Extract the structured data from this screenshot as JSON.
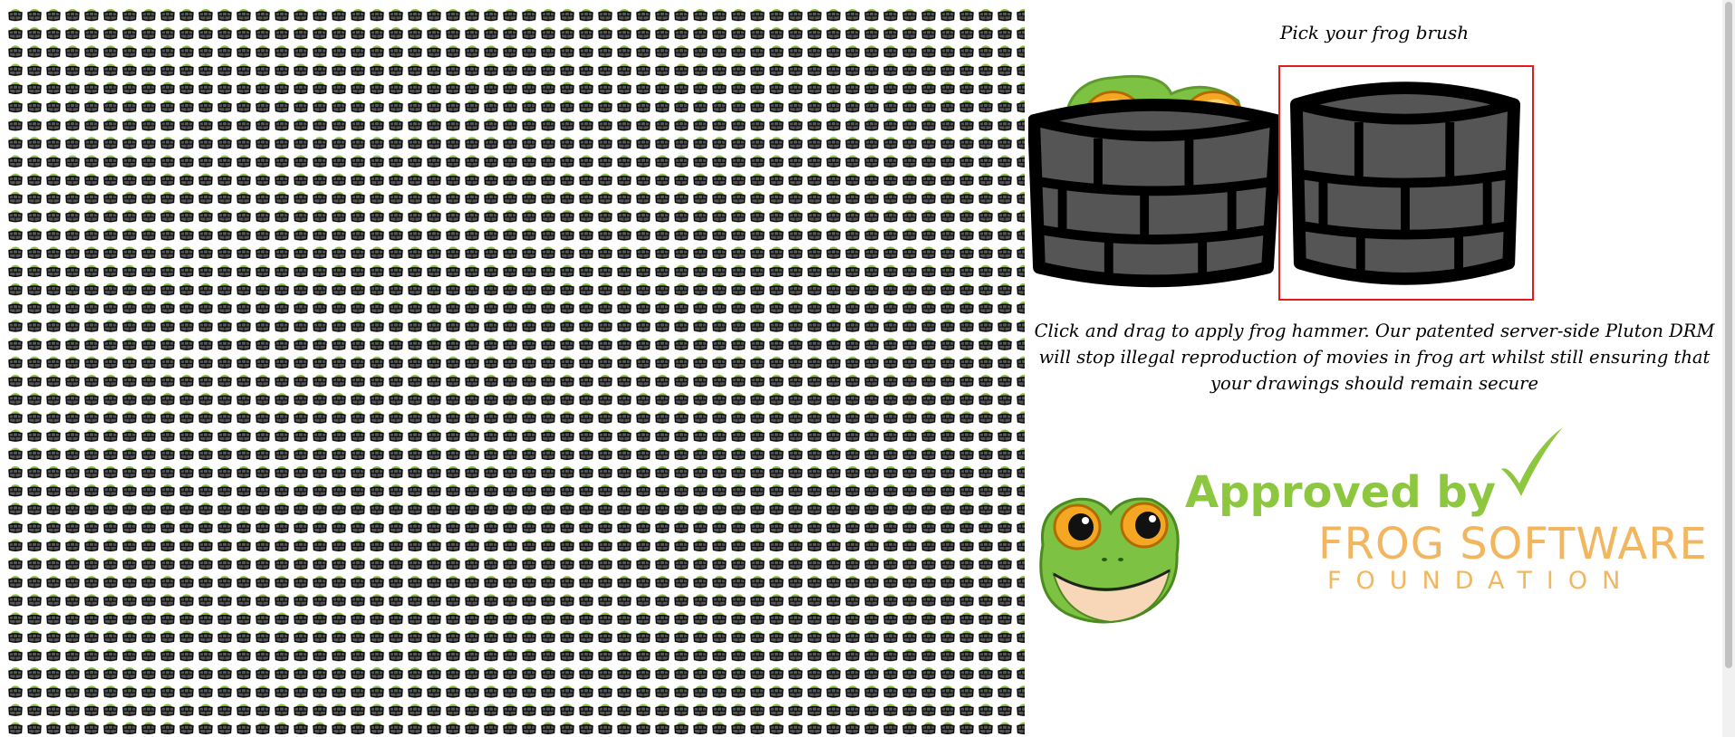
{
  "brush_picker": {
    "title": "Pick your frog brush",
    "brushes": [
      {
        "name": "frog-in-well",
        "selected": false
      },
      {
        "name": "empty-well",
        "selected": true
      }
    ],
    "selected_outline_color": "#e31b1b"
  },
  "instructions": "Click and drag to apply frog hammer. Our patented server-side Pluton DRM will stop illegal reproduction of movies in frog art whilst still ensuring that your drawings should remain secure",
  "badge": {
    "approved_text": "Approved by",
    "org_name": "FROG SOFTWARE",
    "org_sub": "FOUNDATION",
    "icons": [
      "frog-face-icon",
      "checkmark-icon"
    ],
    "colors": {
      "green": "#8dc63f",
      "orange": "#f2b661"
    }
  },
  "canvas": {
    "tile_icon": "frog-well-icon",
    "colors": {
      "well": "#555555",
      "outline": "#000000",
      "frog": "#7dc242"
    }
  }
}
